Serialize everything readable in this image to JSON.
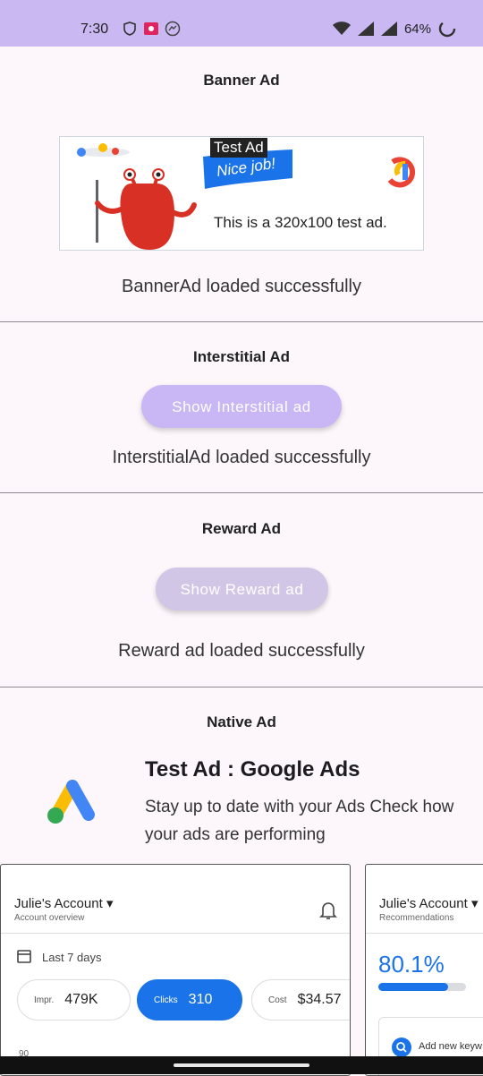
{
  "status_bar": {
    "time": "7:30",
    "battery": "64%"
  },
  "banner_section": {
    "title": "Banner Ad",
    "ad_label": "Test Ad",
    "ad_ribbon": "Nice job!",
    "ad_text": "This is a 320x100 test ad.",
    "status": "BannerAd loaded successfully"
  },
  "interstitial_section": {
    "title": "Interstitial Ad",
    "button_label": "Show Interstitial ad",
    "status": "InterstitialAd loaded successfully"
  },
  "reward_section": {
    "title": "Reward Ad",
    "button_label": "Show Reward ad",
    "status": "Reward ad loaded successfully"
  },
  "native_section": {
    "title": "Native Ad",
    "headline": "Test Ad : Google Ads",
    "body": "Stay up to date with your Ads Check how your ads are performing",
    "cards": [
      {
        "account": "Julie's Account",
        "subtitle": "Account overview",
        "range": "Last 7 days",
        "metrics": [
          {
            "key": "Impr.",
            "value": "479K"
          },
          {
            "key": "Clicks",
            "value": "310"
          },
          {
            "key": "Cost",
            "value": "$34.57"
          }
        ],
        "axis_label": "90"
      },
      {
        "account": "Julie's Account",
        "subtitle": "Recommendations",
        "score": "80.1%",
        "score_fraction": 0.8,
        "action": "Add new keyw"
      }
    ]
  },
  "colors": {
    "status_bar": "#c9b8f2",
    "accent_blue": "#1a73e8",
    "button_primary": "#c8b6f5",
    "button_secondary": "#d2c6e6"
  }
}
